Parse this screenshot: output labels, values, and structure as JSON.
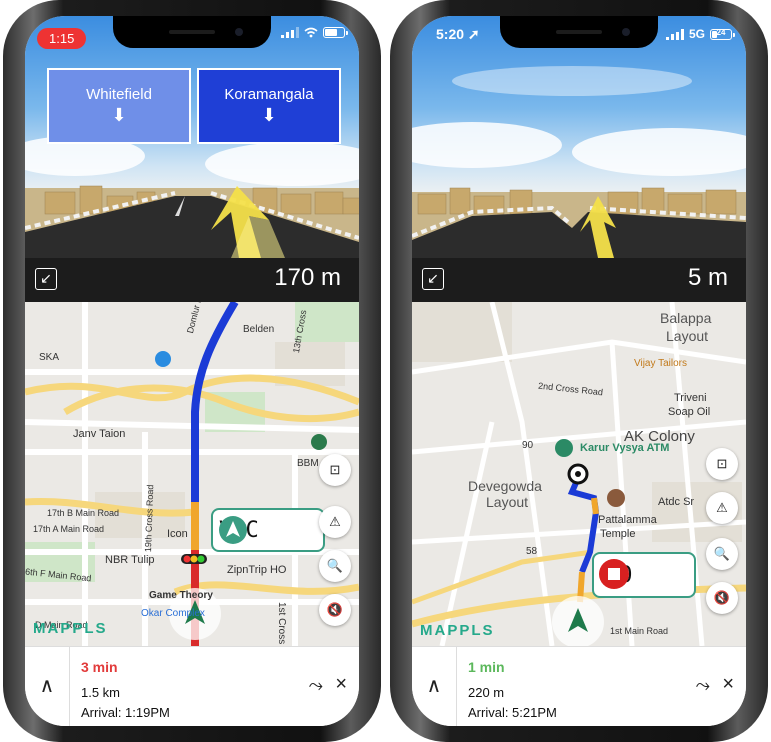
{
  "phones": [
    {
      "status_time": "1:15",
      "signs": [
        "Whitefield",
        "Koramangala"
      ],
      "turn_distance": "170 m",
      "speed_readout": "VAC",
      "map_labels": {
        "road_vertical": "Domlur Inner Ring Road",
        "belden": "Belden",
        "cross13": "13th Cross",
        "ska": "SKA",
        "janv": "Janv Taion",
        "bbm": "BBM",
        "b17": "17th B Main Road",
        "a17": "17th A Main Road",
        "cross19": "19th Cross Road",
        "icon": "Icon",
        "nbr": "NBR Tulip",
        "zipntrip": "ZipnTrip HO",
        "f6": "6th F Main Road",
        "game": "Game Theory",
        "okar": "Okar Complex",
        "dmain": "D Main Road",
        "cross1": "1st Cross"
      },
      "brand": "MAPPLS",
      "eta_time": "3 min",
      "eta_color": "#e23b3b",
      "remaining": "1.5 km",
      "arrival": "Arrival: 1:19PM"
    },
    {
      "status_time": "5:20",
      "network": "5G",
      "battery": "24",
      "turn_distance": "5 m",
      "speed_readout": "10",
      "map_labels": {
        "balappa1": "Balappa",
        "balappa2": "Layout",
        "vijay": "Vijay Tailors",
        "cross2": "2nd Cross Road",
        "triveni1": "Triveni",
        "triveni2": "Soap Oil",
        "ak": "AK Colony",
        "n90": "90",
        "karur": "Karur Vysya ATM",
        "devegowda1": "Devegowda",
        "devegowda2": "Layout",
        "atdc": "Atdc Sr",
        "temple1": "Pattalamma",
        "temple2": "Temple",
        "n58": "58",
        "main1": "1st Main Road"
      },
      "brand": "MAPPLS",
      "eta_time": "1 min",
      "eta_color": "#5cb85c",
      "remaining": "220 m",
      "arrival": "Arrival: 5:21PM"
    }
  ],
  "icons": {
    "shrink": "↙",
    "sign_arrow": "⬇",
    "camera": "⊡",
    "warning": "⚠",
    "search": "🔍",
    "mute": "🔇",
    "expand": "∧",
    "close": "×",
    "reroute": "⤳"
  }
}
